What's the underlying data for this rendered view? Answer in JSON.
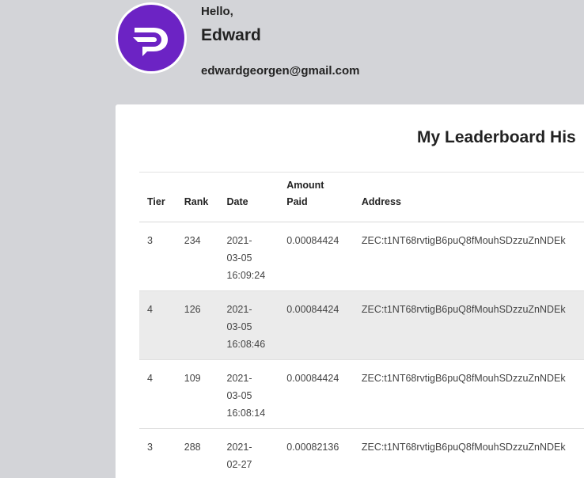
{
  "profile": {
    "greeting": "Hello,",
    "name": "Edward",
    "email": "edwardgeorgen@gmail.com",
    "avatar_icon": "brand-logo-icon",
    "avatar_color": "#6c23c4"
  },
  "leaderboard": {
    "title": "My Leaderboard His",
    "columns": {
      "tier": "Tier",
      "rank": "Rank",
      "date": "Date",
      "amount": "Amount Paid",
      "address": "Address"
    },
    "rows": [
      {
        "tier": "3",
        "rank": "234",
        "date": "2021-03-05 16:09:24",
        "amount": "0.00084424",
        "address": "ZEC:t1NT68rvtigB6puQ8fMouhSDzzuZnNDEk"
      },
      {
        "tier": "4",
        "rank": "126",
        "date": "2021-03-05 16:08:46",
        "amount": "0.00084424",
        "address": "ZEC:t1NT68rvtigB6puQ8fMouhSDzzuZnNDEk"
      },
      {
        "tier": "4",
        "rank": "109",
        "date": "2021-03-05 16:08:14",
        "amount": "0.00084424",
        "address": "ZEC:t1NT68rvtigB6puQ8fMouhSDzzuZnNDEk"
      },
      {
        "tier": "3",
        "rank": "288",
        "date": "2021-02-27",
        "amount": "0.00082136",
        "address": "ZEC:t1NT68rvtigB6puQ8fMouhSDzzuZnNDEk"
      }
    ]
  }
}
